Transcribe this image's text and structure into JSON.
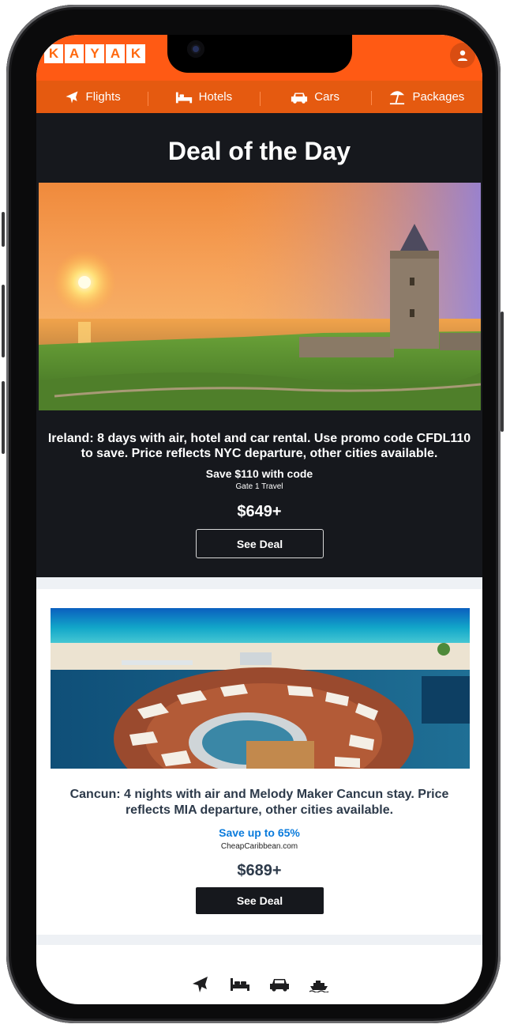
{
  "brand": {
    "logo_letters": [
      "K",
      "A",
      "Y",
      "A",
      "K"
    ],
    "accent": "#ff690f"
  },
  "header": {
    "user_icon": "user-icon"
  },
  "nav": {
    "items": [
      {
        "label": "Flights",
        "icon": "plane-icon"
      },
      {
        "label": "Hotels",
        "icon": "bed-icon"
      },
      {
        "label": "Cars",
        "icon": "car-icon"
      },
      {
        "label": "Packages",
        "icon": "beach-umbrella-icon"
      }
    ]
  },
  "deal_of_day": {
    "title": "Deal of the Day",
    "description": "Ireland: 8 days with air, hotel and car rental. Use promo code CFDL110 to save. Price reflects NYC departure, other cities available.",
    "save_text": "Save $110 with code",
    "provider": "Gate 1 Travel",
    "price": "$649+",
    "button_label": "See Deal"
  },
  "deal_two": {
    "description": "Cancun: 4 nights with air and Melody Maker Cancun stay. Price reflects MIA departure, other cities available.",
    "save_text": "Save up to 65%",
    "provider": "CheapCaribbean.com",
    "price": "$689+",
    "button_label": "See Deal"
  },
  "footer": {
    "icons": [
      "plane-icon",
      "bed-icon",
      "car-icon",
      "cruise-ship-icon"
    ]
  }
}
